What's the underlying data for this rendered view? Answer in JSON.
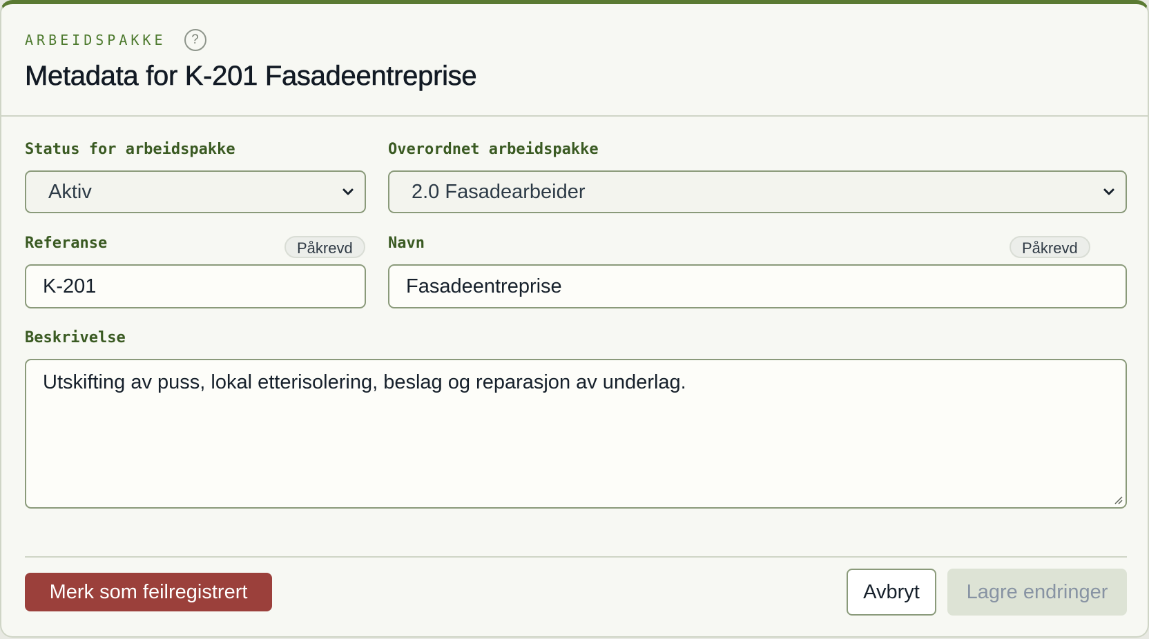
{
  "header": {
    "eyebrow": "ARBEIDSPAKKE",
    "help_icon": "?",
    "title": "Metadata for K-201 Fasadeentreprise"
  },
  "form": {
    "status": {
      "label": "Status for arbeidspakke",
      "value": "Aktiv"
    },
    "parent": {
      "label": "Overordnet arbeidspakke",
      "value": "2.0 Fasadearbeider"
    },
    "reference": {
      "label": "Referanse",
      "required_badge": "Påkrevd",
      "value": "K-201"
    },
    "name": {
      "label": "Navn",
      "required_badge": "Påkrevd",
      "value": "Fasadeentreprise"
    },
    "description": {
      "label": "Beskrivelse",
      "value": "Utskifting av puss, lokal etterisolering, beslag og reparasjon av underlag."
    }
  },
  "actions": {
    "mark_error": "Merk som feilregistrert",
    "cancel": "Avbryt",
    "save": "Lagre endringer"
  },
  "colors": {
    "accent": "#5a7a32",
    "danger": "#9b403b",
    "disabled_bg": "#dde3d5"
  }
}
